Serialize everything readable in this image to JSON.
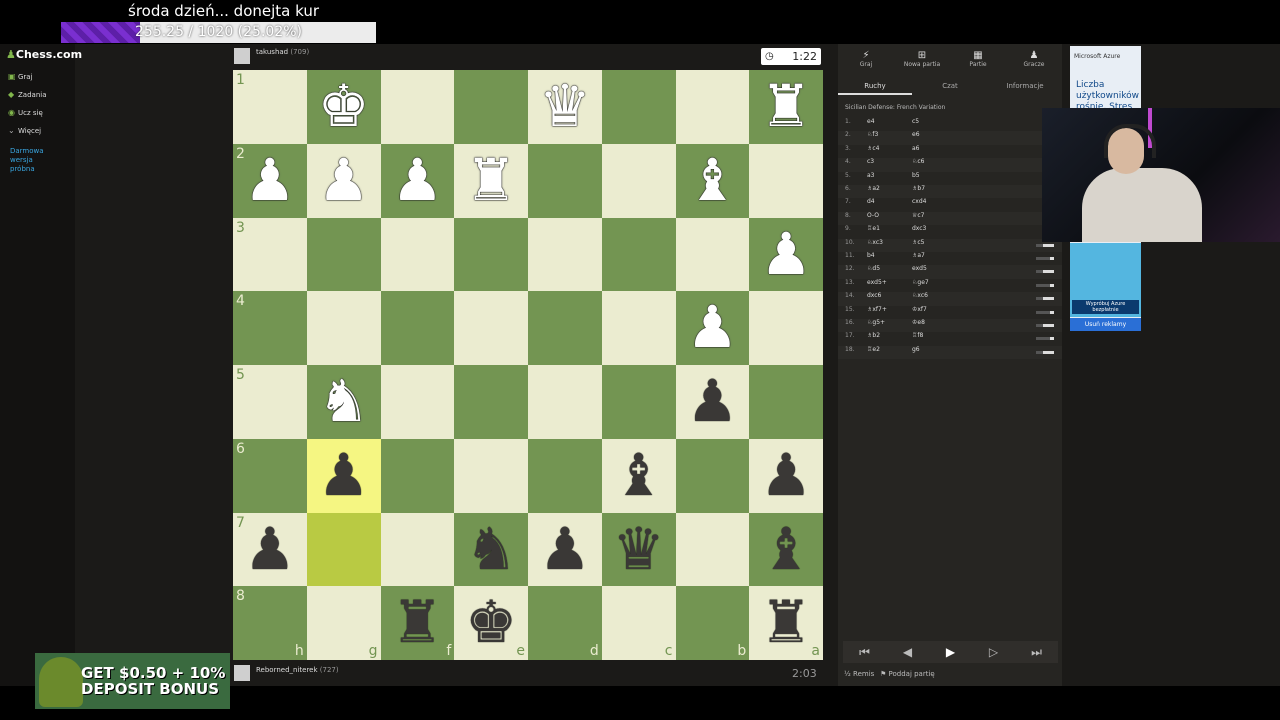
{
  "overlay": {
    "title": "środa dzień... donejta kur",
    "donation_progress": "255.25 / 1020 (25.02%)",
    "donation_fraction": 0.2502
  },
  "sidebar": {
    "logo": "Chess.com",
    "items": [
      {
        "label": "Graj",
        "icon": "play-icon"
      },
      {
        "label": "Zadania",
        "icon": "puzzle-icon"
      },
      {
        "label": "Ucz się",
        "icon": "learn-icon"
      },
      {
        "label": "Więcej",
        "icon": "chevron-down-icon"
      }
    ],
    "trial": [
      "Darmowa",
      "wersja",
      "próbna"
    ]
  },
  "promo": {
    "text": "GET $0.50 + 10% DEPOSIT BONUS"
  },
  "top_player": {
    "name": "takushad",
    "rating": "(709)",
    "clock": "1:22"
  },
  "bottom_player": {
    "name": "Reborned_niterek",
    "rating": "(727)",
    "clock": "2:03"
  },
  "board": {
    "ranks": [
      "1",
      "2",
      "3",
      "4",
      "5",
      "6",
      "7",
      "8"
    ],
    "files": [
      "h",
      "g",
      "f",
      "e",
      "d",
      "c",
      "b",
      "a"
    ],
    "highlighted": [
      "g6",
      "g7"
    ],
    "pieces": [
      {
        "sq": "g1",
        "p": "♚",
        "c": "w"
      },
      {
        "sq": "d1",
        "p": "♛",
        "c": "w"
      },
      {
        "sq": "a1",
        "p": "♜",
        "c": "w"
      },
      {
        "sq": "h2",
        "p": "♟",
        "c": "w"
      },
      {
        "sq": "g2",
        "p": "♟",
        "c": "w"
      },
      {
        "sq": "f2",
        "p": "♟",
        "c": "w"
      },
      {
        "sq": "e2",
        "p": "♜",
        "c": "w"
      },
      {
        "sq": "b2",
        "p": "♝",
        "c": "w"
      },
      {
        "sq": "a3",
        "p": "♟",
        "c": "w"
      },
      {
        "sq": "b4",
        "p": "♟",
        "c": "w"
      },
      {
        "sq": "g5",
        "p": "♞",
        "c": "w"
      },
      {
        "sq": "b5",
        "p": "♟",
        "c": "b"
      },
      {
        "sq": "g6",
        "p": "♟",
        "c": "b"
      },
      {
        "sq": "c6",
        "p": "♝",
        "c": "b"
      },
      {
        "sq": "a6",
        "p": "♟",
        "c": "b"
      },
      {
        "sq": "h7",
        "p": "♟",
        "c": "b"
      },
      {
        "sq": "e7",
        "p": "♞",
        "c": "b"
      },
      {
        "sq": "d7",
        "p": "♟",
        "c": "b"
      },
      {
        "sq": "c7",
        "p": "♛",
        "c": "b"
      },
      {
        "sq": "a7",
        "p": "♝",
        "c": "b"
      },
      {
        "sq": "f8",
        "p": "♜",
        "c": "b"
      },
      {
        "sq": "e8",
        "p": "♚",
        "c": "b"
      },
      {
        "sq": "a8",
        "p": "♜",
        "c": "b"
      }
    ]
  },
  "panel": {
    "tabs": [
      {
        "label": "Graj",
        "icon": "play-icon"
      },
      {
        "label": "Nowa partia",
        "icon": "plus-icon"
      },
      {
        "label": "Partie",
        "icon": "games-icon"
      },
      {
        "label": "Gracze",
        "icon": "players-icon"
      }
    ],
    "subtabs": [
      "Ruchy",
      "Czat",
      "Informacje"
    ],
    "opening": "Sicilian Defense: French Variation",
    "moves": [
      {
        "n": "1.",
        "w": "e4",
        "b": "c5"
      },
      {
        "n": "2.",
        "w": "♘f3",
        "b": "e6"
      },
      {
        "n": "3.",
        "w": "♗c4",
        "b": "a6"
      },
      {
        "n": "4.",
        "w": "c3",
        "b": "♘c6"
      },
      {
        "n": "5.",
        "w": "a3",
        "b": "b5"
      },
      {
        "n": "6.",
        "w": "♗a2",
        "b": "♗b7"
      },
      {
        "n": "7.",
        "w": "d4",
        "b": "cxd4"
      },
      {
        "n": "8.",
        "w": "O-O",
        "b": "♕c7"
      },
      {
        "n": "9.",
        "w": "♖e1",
        "b": "dxc3"
      },
      {
        "n": "10.",
        "w": "♘xc3",
        "b": "♗c5"
      },
      {
        "n": "11.",
        "w": "b4",
        "b": "♗a7"
      },
      {
        "n": "12.",
        "w": "♘d5",
        "b": "exd5"
      },
      {
        "n": "13.",
        "w": "exd5+",
        "b": "♘ge7"
      },
      {
        "n": "14.",
        "w": "dxc6",
        "b": "♘xc6"
      },
      {
        "n": "15.",
        "w": "♗xf7+",
        "b": "♔xf7"
      },
      {
        "n": "16.",
        "w": "♘g5+",
        "b": "♔e8"
      },
      {
        "n": "17.",
        "w": "♗b2",
        "b": "♖f8"
      },
      {
        "n": "18.",
        "w": "♖e2",
        "b": "g6"
      }
    ],
    "nav": [
      "⏮",
      "◀",
      "▶",
      "▷",
      "⏭"
    ],
    "remis": "Remis",
    "resign": "Poddaj partię"
  },
  "ad": {
    "brand": "Microsoft Azure",
    "text": "Liczba użytkowników rośnie. Stres nie",
    "cta": "Wypróbuj Azure bezpłatnie",
    "remove": "Usuń reklamy"
  },
  "colors": {
    "light": "#ebecd0",
    "dark": "#739552",
    "highlight": "#f5f682",
    "accent": "#81b64c"
  }
}
